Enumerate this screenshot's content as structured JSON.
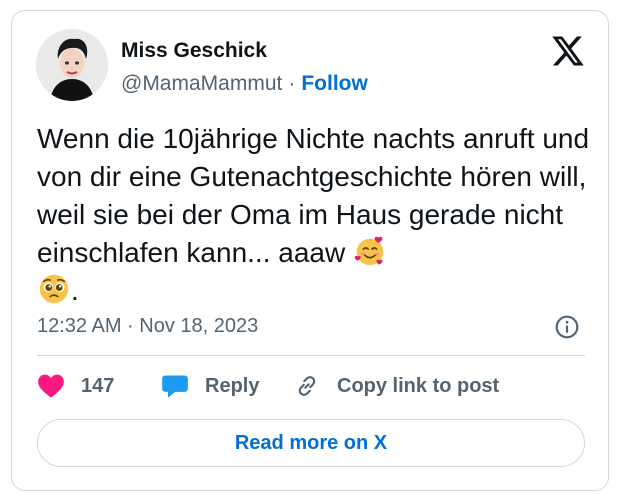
{
  "author": {
    "name": "Miss Geschick",
    "handle": "@MamaMammut",
    "separator": "·",
    "follow_label": "Follow"
  },
  "tweet": {
    "text_main": "Wenn die 10jährige Nichte nachts anruft und von dir eine Gutenachtgeschichte hören will, weil sie bei der Oma im Haus gerade nicht einschlafen kann... aaaw ",
    "text_end": ".",
    "emojis": [
      "smiling-face-with-hearts-icon",
      "pleading-face-icon"
    ]
  },
  "timestamp": "12:32 AM · Nov 18, 2023",
  "actions": {
    "like_count": "147",
    "reply_label": "Reply",
    "copy_label": "Copy link to post"
  },
  "read_more_label": "Read more on X",
  "colors": {
    "link_blue": "#006fd6",
    "like_pink": "#f91880",
    "reply_blue": "#1d9bf0",
    "muted": "#536471",
    "border": "#cfd9de"
  }
}
